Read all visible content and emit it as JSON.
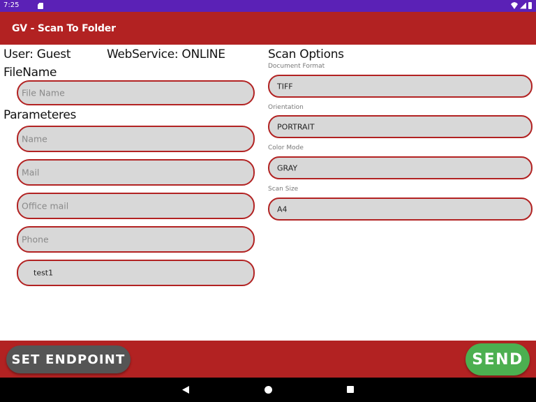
{
  "status_bar": {
    "time": "7:25"
  },
  "app_bar": {
    "title": "GV - Scan To Folder"
  },
  "user": {
    "label": "User: Guest"
  },
  "webservice": {
    "label": "WebService: ONLINE"
  },
  "filename": {
    "label": "FileName",
    "placeholder": "File Name"
  },
  "parameters": {
    "label": "Parameteres",
    "fields": [
      {
        "placeholder": "Name",
        "value": ""
      },
      {
        "placeholder": "Mail",
        "value": ""
      },
      {
        "placeholder": "Office mail",
        "value": ""
      },
      {
        "placeholder": "Phone",
        "value": ""
      },
      {
        "placeholder": "",
        "value": "test1"
      }
    ]
  },
  "scan_options": {
    "title": "Scan Options",
    "document_format": {
      "label": "Document Format",
      "value": "TIFF"
    },
    "orientation": {
      "label": "Orientation",
      "value": "PORTRAIT"
    },
    "color_mode": {
      "label": "Color Mode",
      "value": "GRAY"
    },
    "scan_size": {
      "label": "Scan Size",
      "value": "A4"
    }
  },
  "buttons": {
    "set_endpoint": "SET ENDPOINT",
    "send": "SEND"
  },
  "colors": {
    "status_bar": "#5b21b6",
    "accent": "#b22222",
    "send": "#4caf50",
    "field_bg": "#d8d8d8"
  }
}
